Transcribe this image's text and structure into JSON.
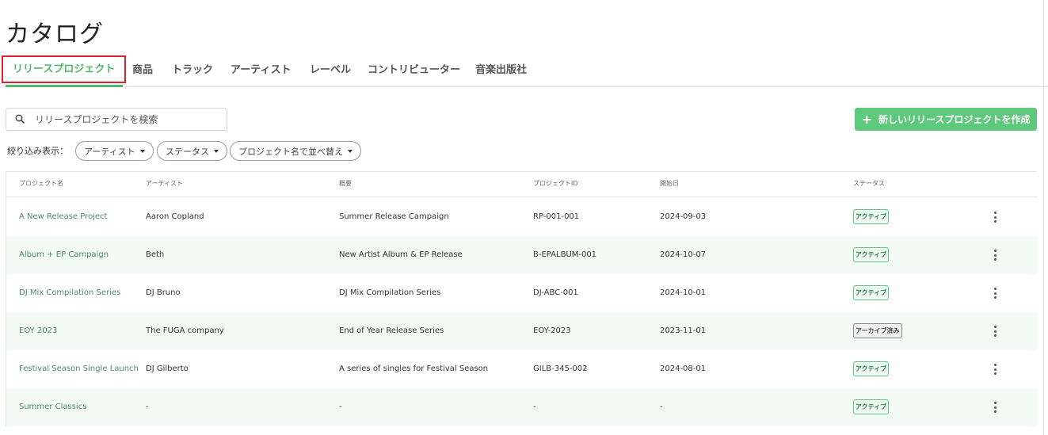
{
  "page": {
    "title": "カタログ"
  },
  "tabs": [
    {
      "label": "リリースプロジェクト",
      "active": true
    },
    {
      "label": "商品"
    },
    {
      "label": "トラック"
    },
    {
      "label": "アーティスト"
    },
    {
      "label": "レーベル"
    },
    {
      "label": "コントリビューター"
    },
    {
      "label": "音楽出版社"
    }
  ],
  "search": {
    "placeholder": "リリースプロジェクトを検索",
    "value": ""
  },
  "toolbar": {
    "create_label": "新しいリリースプロジェクトを作成",
    "create_icon": "plus-icon"
  },
  "filters": {
    "label": "絞り込み表示：",
    "artist": "アーティスト",
    "status": "ステータス",
    "sort": "プロジェクト名で並べ替え"
  },
  "table": {
    "headers": {
      "name": "プロジェクト名",
      "artist": "アーティスト",
      "summary": "概要",
      "project_id": "プロジェクトID",
      "start_date": "開始日",
      "status": "ステータス"
    },
    "rows": [
      {
        "name": "A New Release Project",
        "artist": "Aaron Copland",
        "summary": "Summer Release Campaign",
        "project_id": "RP-001-001",
        "start_date": "2024-09-03",
        "status": "アクティブ"
      },
      {
        "name": "Album + EP Campaign",
        "artist": "Beth",
        "summary": "New Artist Album & EP Release",
        "project_id": "B-EPALBUM-001",
        "start_date": "2024-10-07",
        "status": "アクティブ"
      },
      {
        "name": "DJ Mix Compilation Series",
        "artist": "DJ Bruno",
        "summary": "DJ Mix Compilation Series",
        "project_id": "DJ-ABC-001",
        "start_date": "2024-10-01",
        "status": "アクティブ"
      },
      {
        "name": "EOY 2023",
        "artist": "The FUGA company",
        "summary": "End of Year Release Series",
        "project_id": "EOY-2023",
        "start_date": "2023-11-01",
        "status": "アーカイブ済み"
      },
      {
        "name": "Festival Season Single Launch",
        "artist": "DJ Gilberto",
        "summary": "A series of singles for Festival Season",
        "project_id": "GILB-345-002",
        "start_date": "2024-08-01",
        "status": "アクティブ"
      },
      {
        "name": "Summer Classics",
        "artist": "-",
        "summary": "-",
        "project_id": "-",
        "start_date": "-",
        "status": "アクティブ"
      }
    ]
  },
  "colors": {
    "accent": "#4fb96c",
    "button": "#5ec97c",
    "highlight_box": "#e0202a",
    "link": "#4a8c66"
  }
}
